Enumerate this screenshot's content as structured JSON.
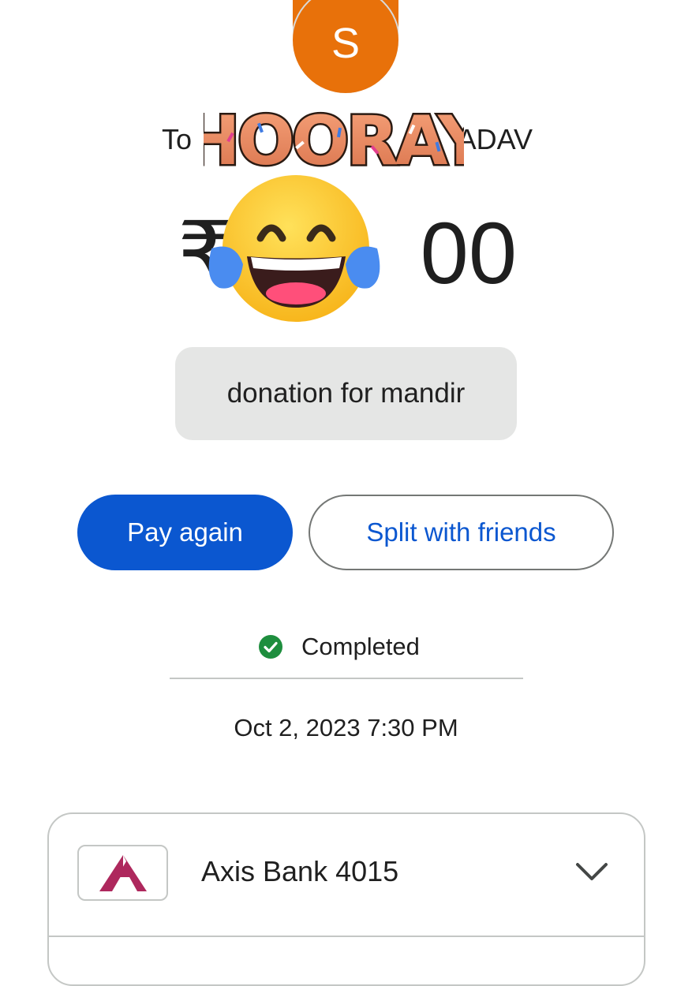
{
  "avatar": {
    "initial": "S",
    "color": "#e8710a"
  },
  "recipient": {
    "prefix": "To",
    "name_visible_end": "ADAV"
  },
  "sticker_text": "HOORAY",
  "amount": {
    "currency_symbol": "₹",
    "visible_digits": "00"
  },
  "note": "donation for mandir",
  "buttons": {
    "pay_again": "Pay again",
    "split": "Split with friends"
  },
  "status": {
    "label": "Completed",
    "color": "#1e8e3e"
  },
  "datetime": "Oct 2, 2023 7:30 PM",
  "bank": {
    "name": "Axis Bank 4015",
    "logo_color": "#ae285d"
  },
  "colors": {
    "primary": "#0b57d0"
  }
}
